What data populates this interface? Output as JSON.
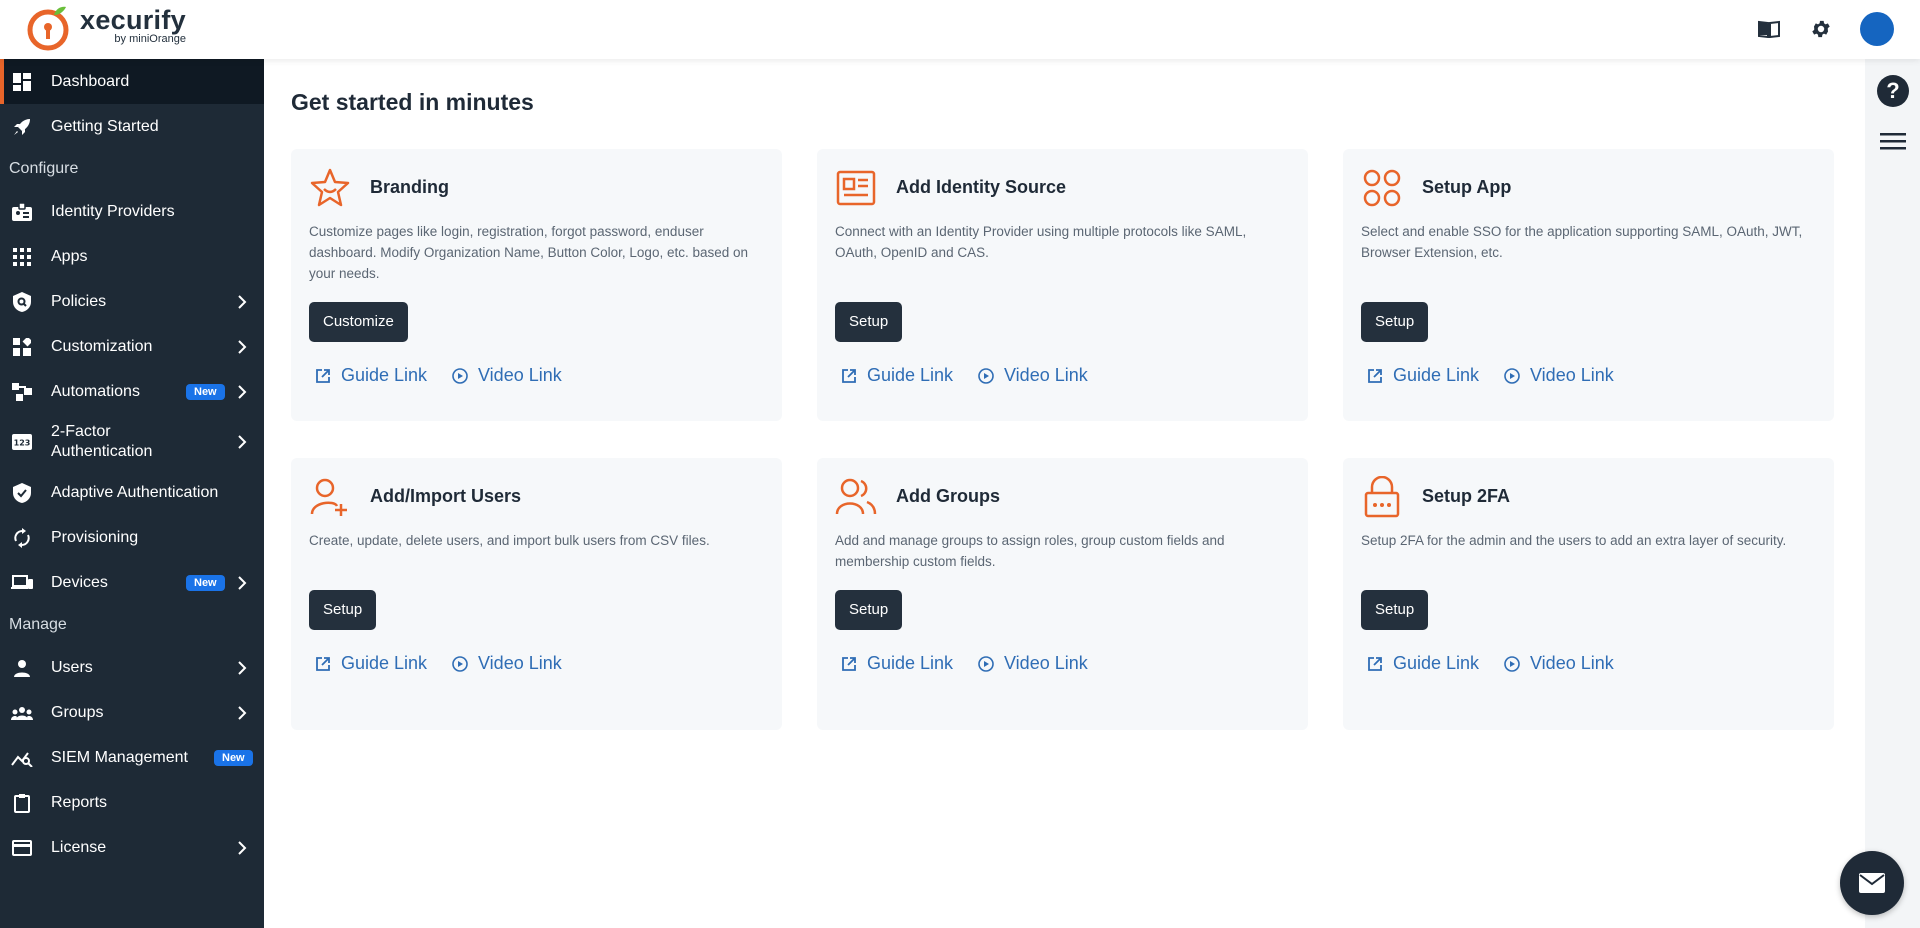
{
  "brand": {
    "name": "xecurify",
    "by": "by miniOrange",
    "accent": "#e8652a",
    "sidebar_bg": "#1e2a36"
  },
  "header": {
    "icons": [
      "book-icon",
      "gear-icon",
      "avatar"
    ]
  },
  "sidebar": {
    "dashboard": "Dashboard",
    "getting_started": "Getting Started",
    "configure_label": "Configure",
    "identity_providers": "Identity Providers",
    "apps": "Apps",
    "policies": "Policies",
    "customization": "Customization",
    "automations": "Automations",
    "automations_badge": "New",
    "two_factor_line1": "2-Factor",
    "two_factor_line2": "Authentication",
    "adaptive": "Adaptive Authentication",
    "provisioning": "Provisioning",
    "devices": "Devices",
    "devices_badge": "New",
    "manage_label": "Manage",
    "users": "Users",
    "groups": "Groups",
    "siem": "SIEM Management",
    "siem_badge": "New",
    "reports": "Reports",
    "license": "License"
  },
  "main": {
    "title": "Get started in minutes",
    "guide_label": "Guide Link",
    "video_label": "Video Link",
    "cards": [
      {
        "title": "Branding",
        "desc": "Customize pages like login, registration, forgot password, enduser dashboard. Modify Organization Name, Button Color, Logo, etc. based on your needs.",
        "button": "Customize"
      },
      {
        "title": "Add Identity Source",
        "desc": "Connect with an Identity Provider using multiple protocols like SAML, OAuth, OpenID and CAS.",
        "button": "Setup"
      },
      {
        "title": "Setup App",
        "desc": "Select and enable SSO for the application supporting SAML, OAuth, JWT, Browser Extension, etc.",
        "button": "Setup"
      },
      {
        "title": "Add/Import Users",
        "desc": "Create, update, delete users, and import bulk users from CSV files.",
        "button": "Setup"
      },
      {
        "title": "Add Groups",
        "desc": "Add and manage groups to assign roles, group custom fields and membership custom fields.",
        "button": "Setup"
      },
      {
        "title": "Setup 2FA",
        "desc": "Setup 2FA for the admin and the users to add an extra layer of security.",
        "button": "Setup"
      }
    ]
  },
  "rail": {
    "help": "?"
  }
}
